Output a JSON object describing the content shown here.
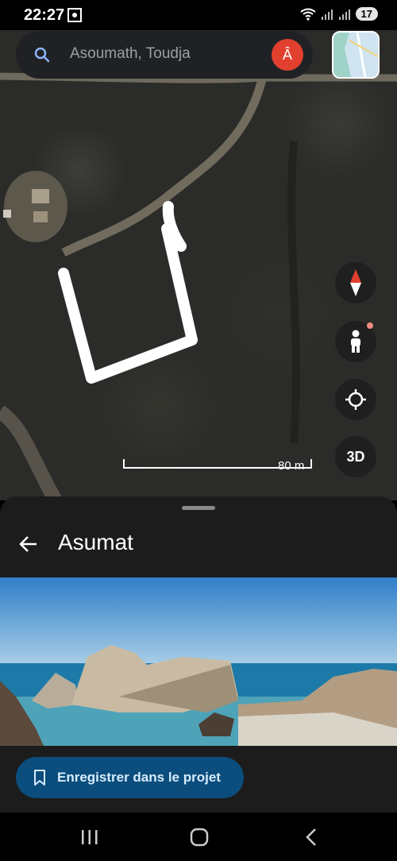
{
  "status": {
    "time": "22:27",
    "battery": "17"
  },
  "search": {
    "query": "Asoumath, Toudja",
    "avatar_letter": "Â"
  },
  "map": {
    "scale_label": "80 m",
    "btn_3d_label": "3D"
  },
  "sheet": {
    "title": "Asumat",
    "save_label": "Enregistrer dans le projet"
  },
  "colors": {
    "accent": "#0b4d7c",
    "avatar": "#e2402f",
    "compass_red": "#e2402f"
  }
}
